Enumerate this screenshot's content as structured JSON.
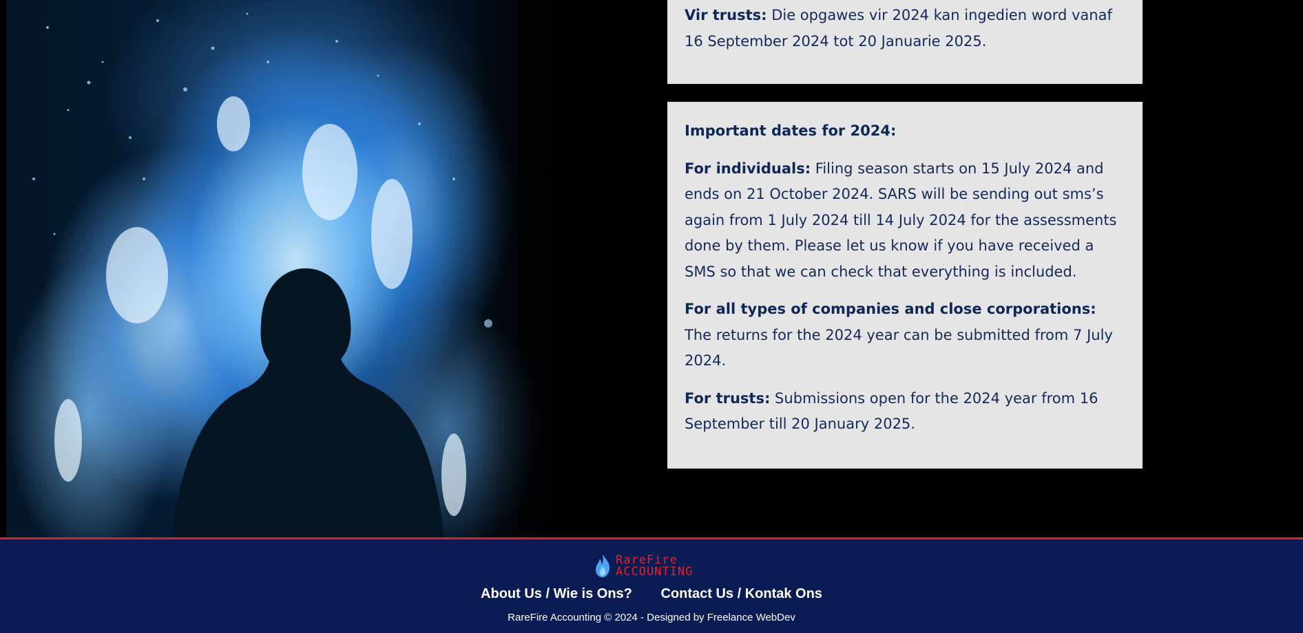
{
  "hero": {
    "alt": "Silhouette of a person in front of a blue fire"
  },
  "cards": [
    {
      "paragraphs": [
        {
          "bold": "Vir trusts:",
          "text": " Die opgawes vir 2024 kan ingedien word vanaf 16 September 2024 tot 20 Januarie 2025."
        }
      ]
    },
    {
      "heading": "Important dates for 2024:",
      "paragraphs": [
        {
          "bold": "For individuals:",
          "text": " Filing season starts on 15 July 2024 and ends on 21 October 2024. SARS will be sending out sms’s again from 1 July 2024 till 14 July 2024 for the assessments done by them. Please let us know if you have received a SMS so that we can check that everything is included."
        },
        {
          "bold": "For all types of companies and close corporations:",
          "text": " The returns for the 2024 year can be submitted from 7 July 2024."
        },
        {
          "bold": "For trusts:",
          "text": " Submissions open for the 2024 year from 16 September till 20 January 2025."
        }
      ]
    }
  ],
  "footer": {
    "logo": {
      "line1": "RareFire",
      "line2": "ACCOUNTING"
    },
    "nav": [
      "About Us / Wie is Ons?",
      "Contact Us / Kontak Ons"
    ],
    "copyright": "RareFire Accounting © 2024 - Designed by Freelance WebDev"
  },
  "colors": {
    "card_bg": "#e5e5e5",
    "card_text": "#13295a",
    "footer_bg": "#0b1b54",
    "accent_red": "#d2262a",
    "fire_blue": "#4aa3f5"
  }
}
